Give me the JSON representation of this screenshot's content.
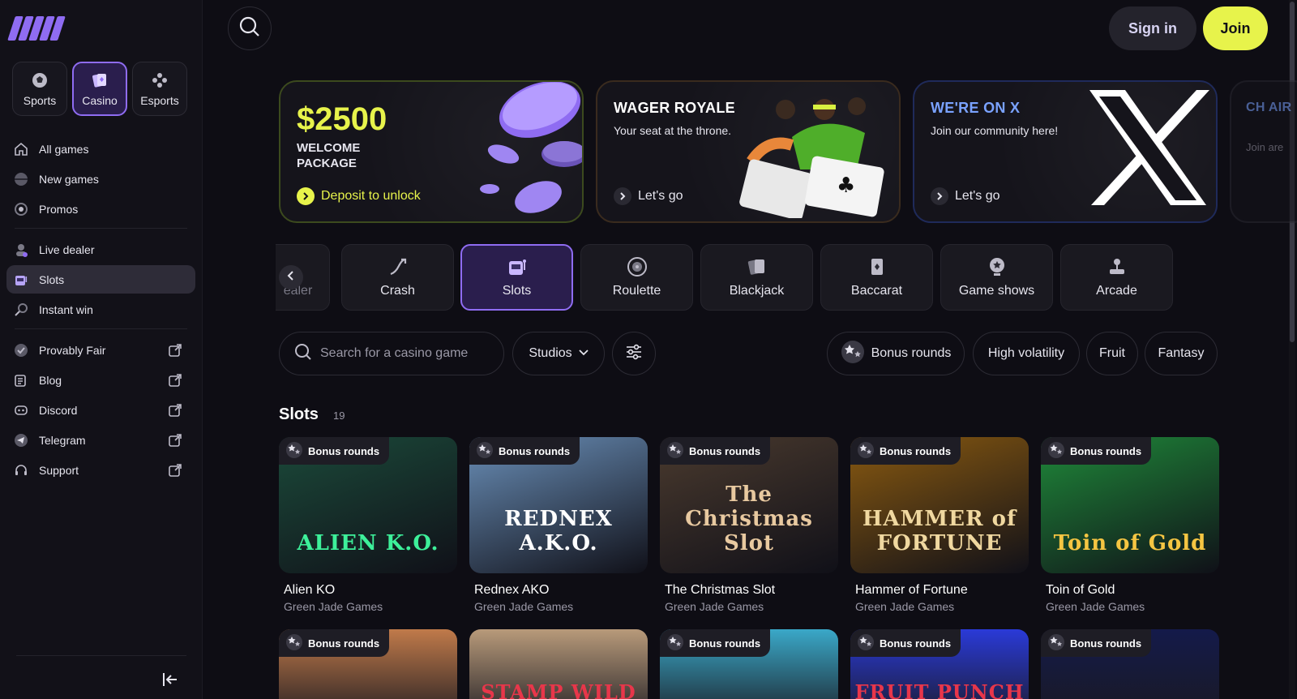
{
  "sidebar": {
    "categories": [
      {
        "label": "Sports",
        "icon": "soccer-ball-icon"
      },
      {
        "label": "Casino",
        "icon": "casino-cards-icon"
      },
      {
        "label": "Esports",
        "icon": "gamepad-icon"
      }
    ],
    "nav_group_1": [
      {
        "label": "All games",
        "icon": "home-icon"
      },
      {
        "label": "New games",
        "icon": "new-games-icon"
      },
      {
        "label": "Promos",
        "icon": "promos-icon"
      }
    ],
    "nav_group_2": [
      {
        "label": "Live dealer",
        "icon": "dealer-icon"
      },
      {
        "label": "Slots",
        "icon": "slot-machine-icon"
      },
      {
        "label": "Instant win",
        "icon": "instant-win-icon"
      }
    ],
    "nav_group_3": [
      {
        "label": "Provably Fair",
        "icon": "fair-icon"
      },
      {
        "label": "Blog",
        "icon": "blog-icon"
      },
      {
        "label": "Discord",
        "icon": "discord-icon"
      },
      {
        "label": "Telegram",
        "icon": "telegram-icon"
      },
      {
        "label": "Support",
        "icon": "headset-icon"
      }
    ]
  },
  "header": {
    "signin_label": "Sign in",
    "join_label": "Join"
  },
  "banners": {
    "welcome": {
      "amount": "$2500",
      "line1": "WELCOME",
      "line2": "PACKAGE",
      "cta": "Deposit to unlock"
    },
    "wager": {
      "title": "WAGER ROYALE",
      "desc": "Your seat at the throne.",
      "cta": "Let's go"
    },
    "x": {
      "title": "WE'RE ON X",
      "desc": "Join our community here!",
      "cta": "Let's go"
    },
    "partial": {
      "title": "CH AIR",
      "desc": "Join are"
    }
  },
  "chips": [
    {
      "label": "ealer",
      "icon": "dealer-icon"
    },
    {
      "label": "Crash",
      "icon": "crash-icon"
    },
    {
      "label": "Slots",
      "icon": "slot-machine-icon"
    },
    {
      "label": "Roulette",
      "icon": "roulette-icon"
    },
    {
      "label": "Blackjack",
      "icon": "cards-icon"
    },
    {
      "label": "Baccarat",
      "icon": "card-icon"
    },
    {
      "label": "Game shows",
      "icon": "game-show-icon"
    },
    {
      "label": "Arcade",
      "icon": "joystick-icon"
    }
  ],
  "filters": {
    "search_placeholder": "Search for a casino game",
    "studios_label": "Studios",
    "tags": [
      "Bonus rounds",
      "High volatility",
      "Fruit",
      "Fantasy"
    ]
  },
  "section": {
    "title": "Slots",
    "count": "19"
  },
  "badge_label": "Bonus rounds",
  "games": [
    {
      "name": "Alien KO",
      "studio": "Green Jade Games",
      "art": "ALIEN K.O.",
      "bg": "#1b4a3a",
      "art_color": "#3df09a"
    },
    {
      "name": "Rednex AKO",
      "studio": "Green Jade Games",
      "art": "REDNEX A.K.O.",
      "bg": "#6a8fb8",
      "art_color": "#ffffff"
    },
    {
      "name": "The Christmas Slot",
      "studio": "Green Jade Games",
      "art": "The Christmas Slot",
      "bg": "#4a3a2e",
      "art_color": "#e8c9a0"
    },
    {
      "name": "Hammer of Fortune",
      "studio": "Green Jade Games",
      "art": "HAMMER of FORTUNE",
      "bg": "#8a5a10",
      "art_color": "#f0d8a0"
    },
    {
      "name": "Toin of Gold",
      "studio": "Green Jade Games",
      "art": "Toin of Gold",
      "bg": "#1f8a3a",
      "art_color": "#f5c542"
    }
  ],
  "games_row2": [
    {
      "art": "",
      "bg": "#c07a4a",
      "badge": true
    },
    {
      "art": "STAMP WILD",
      "bg": "#b89a7a",
      "badge": false
    },
    {
      "art": "",
      "bg": "#3aa8c8",
      "badge": true
    },
    {
      "art": "FRUIT PUNCH",
      "bg": "#2a3ad8",
      "badge": true
    },
    {
      "art": "",
      "bg": "#141a4a",
      "badge": true
    }
  ],
  "colors": {
    "accent": "#8f6cf2",
    "cta_yellow": "#e7f34b",
    "background": "#0e0d14"
  }
}
